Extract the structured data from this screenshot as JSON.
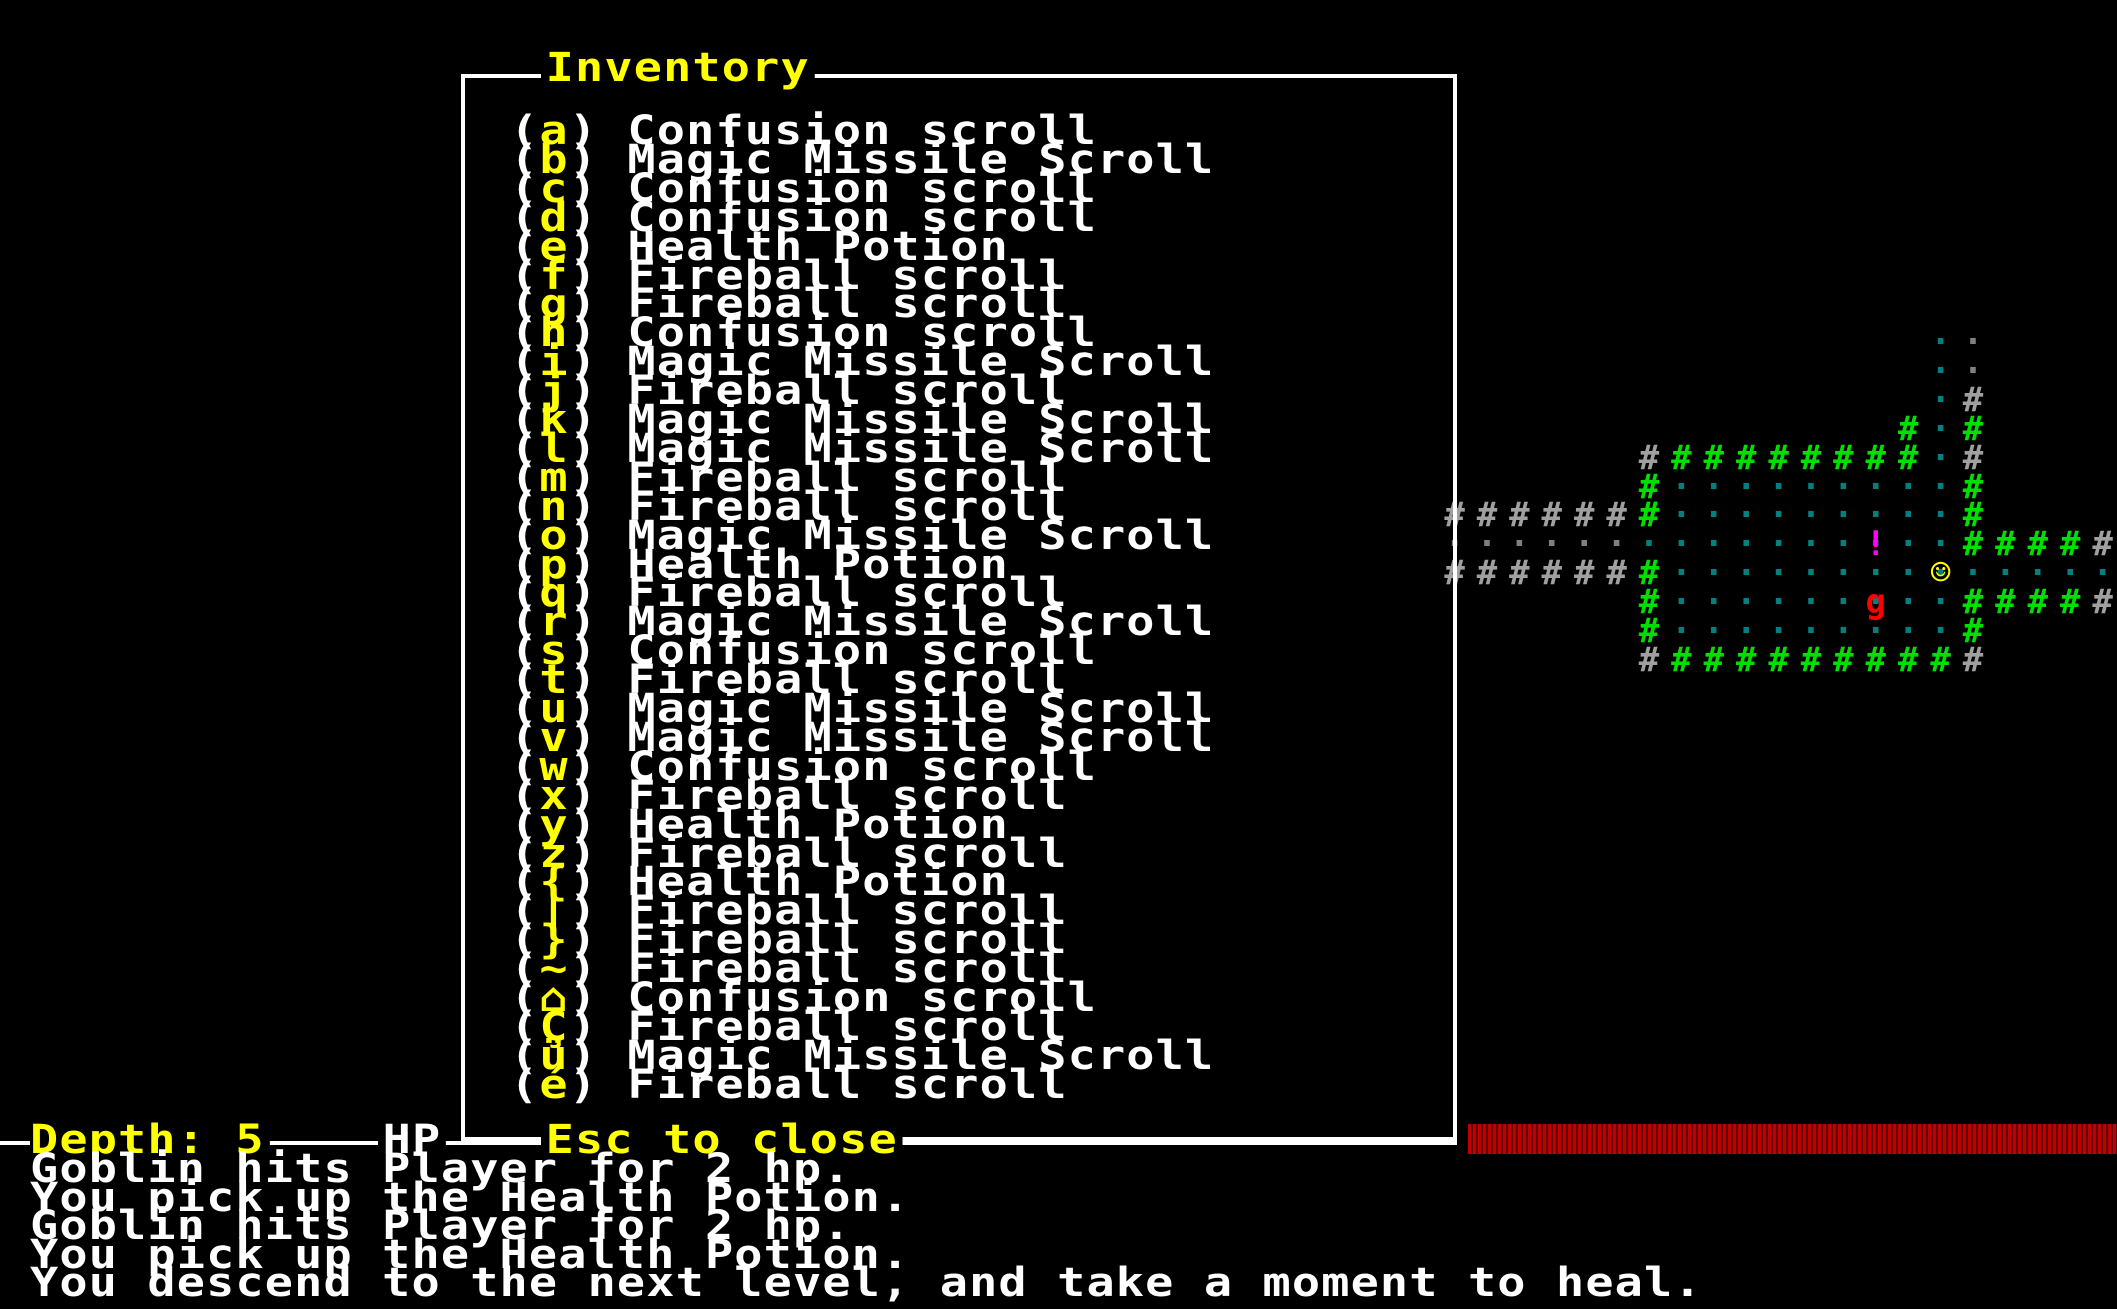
{
  "inventory": {
    "title": "Inventory",
    "footer": "Esc to close",
    "items": [
      {
        "key": "a",
        "name": "Confusion scroll"
      },
      {
        "key": "b",
        "name": "Magic Missile Scroll"
      },
      {
        "key": "c",
        "name": "Confusion scroll"
      },
      {
        "key": "d",
        "name": "Confusion scroll"
      },
      {
        "key": "e",
        "name": "Health Potion"
      },
      {
        "key": "f",
        "name": "Fireball scroll"
      },
      {
        "key": "g",
        "name": "Fireball scroll"
      },
      {
        "key": "h",
        "name": "Confusion scroll"
      },
      {
        "key": "i",
        "name": "Magic Missile Scroll"
      },
      {
        "key": "j",
        "name": "Fireball scroll"
      },
      {
        "key": "k",
        "name": "Magic Missile Scroll"
      },
      {
        "key": "l",
        "name": "Magic Missile Scroll"
      },
      {
        "key": "m",
        "name": "Fireball scroll"
      },
      {
        "key": "n",
        "name": "Fireball scroll"
      },
      {
        "key": "o",
        "name": "Magic Missile Scroll"
      },
      {
        "key": "p",
        "name": "Health Potion"
      },
      {
        "key": "q",
        "name": "Fireball scroll"
      },
      {
        "key": "r",
        "name": "Magic Missile Scroll"
      },
      {
        "key": "s",
        "name": "Confusion scroll"
      },
      {
        "key": "t",
        "name": "Fireball scroll"
      },
      {
        "key": "u",
        "name": "Magic Missile Scroll"
      },
      {
        "key": "v",
        "name": "Magic Missile Scroll"
      },
      {
        "key": "w",
        "name": "Confusion scroll"
      },
      {
        "key": "x",
        "name": "Fireball scroll"
      },
      {
        "key": "y",
        "name": "Health Potion"
      },
      {
        "key": "z",
        "name": "Fireball scroll"
      },
      {
        "key": "{",
        "name": "Health Potion"
      },
      {
        "key": "|",
        "name": "Fireball scroll"
      },
      {
        "key": "}",
        "name": "Fireball scroll"
      },
      {
        "key": "~",
        "name": "Fireball scroll"
      },
      {
        "key": "⌂",
        "name": "Confusion scroll"
      },
      {
        "key": "Ç",
        "name": "Fireball scroll"
      },
      {
        "key": "ü",
        "name": "Magic Missile Scroll"
      },
      {
        "key": "é",
        "name": "Fireball scroll"
      }
    ]
  },
  "status": {
    "depth": "Depth: 5",
    "hp_label": "HP"
  },
  "log": [
    "Goblin hits Player for 2 hp.",
    "You pick up the Health Potion.",
    "Goblin hits Player for 2 hp.",
    "You pick up the Health Potion.",
    "You descend to the next level, and take a moment to heal."
  ],
  "map": {
    "player_glyph": "☺",
    "goblin_glyph": "g",
    "potion_glyph": "!",
    "wall_glyph": "#",
    "colors": {
      "wall_lit": "#00e000",
      "wall_remembered": "#a0a0a0",
      "floor_lit": "#008080",
      "floor_remembered": "#808080",
      "player": "#ffff00",
      "goblin": "#ff0000",
      "potion": "#ff00ff",
      "accent": "#ffff00"
    }
  }
}
